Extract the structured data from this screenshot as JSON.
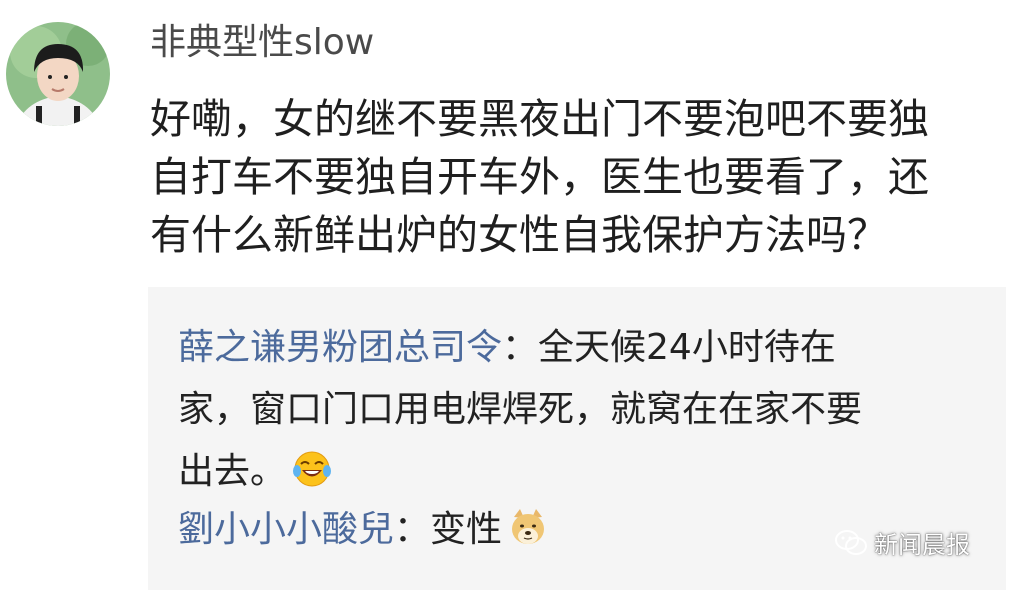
{
  "post": {
    "username": "非典型性slow",
    "comment_lines": [
      "好嘞，女的继不要黑夜出门不要泡吧不要独",
      "自打车不要独自开车外，医生也要看了，还",
      "有什么新鲜出炉的女性自我保护方法吗？"
    ]
  },
  "replies": [
    {
      "author": "薛之谦男粉团总司令",
      "separator": "：",
      "line1_text": "全天候24小时待在",
      "line2_text": "家，窗口门口用电焊焊死，就窝在在家不要",
      "line3_text": "出去。",
      "emoji_icon": "laughing-tears-emoji"
    },
    {
      "author": "劉小小小酸兒",
      "separator": "：",
      "text": "变性",
      "emoji_icon": "doge-emoji"
    }
  ],
  "watermark": {
    "label": "新闻晨报",
    "icon": "wechat-icon"
  },
  "colors": {
    "username": "#4a4a4a",
    "reply_author": "#4c6a9c",
    "reply_background": "#f5f5f5"
  }
}
